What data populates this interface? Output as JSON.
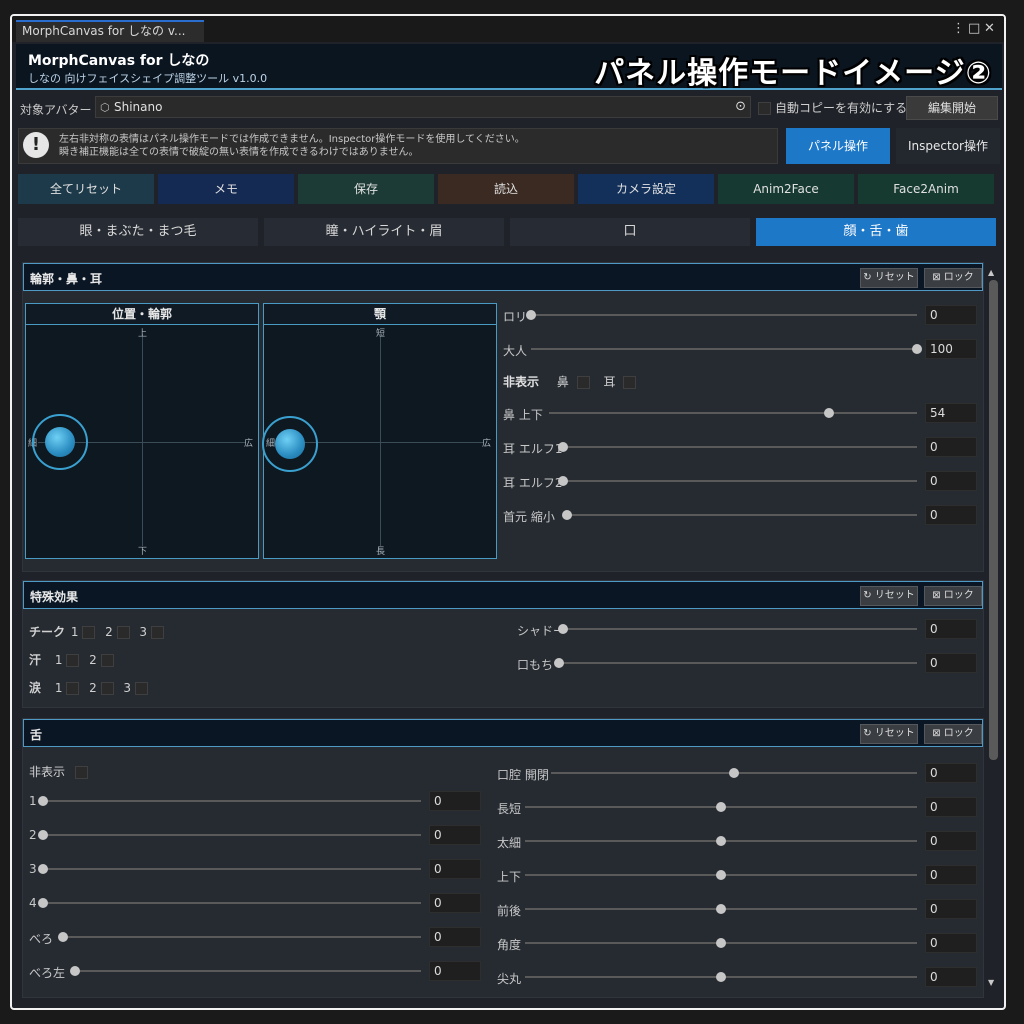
{
  "window": {
    "tab_title": "MorphCanvas for しなの v...",
    "app_title": "MorphCanvas for しなの",
    "app_subtitle": "しなの 向けフェイスシェイプ調整ツール v1.0.0",
    "overlay_caption": "パネル操作モードイメージ②",
    "ctl_menu": "⋮",
    "ctl_max": "□",
    "ctl_close": "✕"
  },
  "target": {
    "label": "対象アバター",
    "avatar_name": "Shinano",
    "auto_copy_label": "自動コピーを有効にする",
    "edit_start": "編集開始"
  },
  "warning": {
    "icon": "!",
    "line1": "左右非対称の表情はパネル操作モードでは作成できません。Inspector操作モードを使用してください。",
    "line2": "瞬き補正機能は全ての表情で破綻の無い表情を作成できるわけではありません。"
  },
  "modes": {
    "panel": "パネル操作",
    "inspector": "Inspector操作"
  },
  "actions": [
    {
      "label": "全てリセット",
      "color": "#1d3a4a"
    },
    {
      "label": "メモ",
      "color": "#142a52"
    },
    {
      "label": "保存",
      "color": "#1d3b36"
    },
    {
      "label": "読込",
      "color": "#3a2a22"
    },
    {
      "label": "カメラ設定",
      "color": "#13305a"
    },
    {
      "label": "Anim2Face",
      "color": "#163a32"
    },
    {
      "label": "Face2Anim",
      "color": "#163a30"
    }
  ],
  "categories": [
    {
      "label": "眼・まぶた・まつ毛"
    },
    {
      "label": "瞳・ハイライト・眉"
    },
    {
      "label": "口"
    },
    {
      "label": "顔・舌・歯"
    }
  ],
  "common": {
    "reset": "↻ リセット",
    "lock": "⊠ ロック"
  },
  "contour": {
    "title": "輪郭・鼻・耳",
    "pad1": {
      "title": "位置・輪郭",
      "top": "上",
      "bottom": "下",
      "left": "細",
      "right": "広"
    },
    "pad2": {
      "title": "顎",
      "top": "短",
      "bottom": "長",
      "left": "細",
      "right": "広"
    },
    "sliders": [
      {
        "label": "ロリ",
        "value": "0",
        "pos": 0
      },
      {
        "label": "大人",
        "value": "100",
        "pos": 1
      },
      {
        "label": "鼻 上下",
        "value": "54",
        "pos": 0.76
      },
      {
        "label": "耳 エルフ1",
        "value": "0",
        "pos": 0
      },
      {
        "label": "耳 エルフ2",
        "value": "0",
        "pos": 0
      },
      {
        "label": "首元 縮小",
        "value": "0",
        "pos": 0
      }
    ],
    "hide": {
      "label": "非表示",
      "nose": "鼻",
      "ear": "耳"
    }
  },
  "special": {
    "title": "特殊効果",
    "cheek": "チーク",
    "sweat": "汗",
    "tears": "涙",
    "n1": "1",
    "n2": "2",
    "n3": "3",
    "sliders": [
      {
        "label": "シャドー",
        "value": "0",
        "pos": 0
      },
      {
        "label": "口もち",
        "value": "0",
        "pos": 0
      }
    ]
  },
  "tongue": {
    "title": "舌",
    "hide_label": "非表示",
    "left": [
      {
        "label": "1",
        "value": "0",
        "pos": 0
      },
      {
        "label": "2",
        "value": "0",
        "pos": 0
      },
      {
        "label": "3",
        "value": "0",
        "pos": 0
      },
      {
        "label": "4",
        "value": "0",
        "pos": 0
      },
      {
        "label": "べろ",
        "value": "0",
        "pos": 0
      },
      {
        "label": "べろ左",
        "value": "0",
        "pos": 0
      }
    ],
    "right": [
      {
        "label": "口腔 開閉",
        "value": "0",
        "pos": 0.5
      },
      {
        "label": "長短",
        "value": "0",
        "pos": 0.5
      },
      {
        "label": "太細",
        "value": "0",
        "pos": 0.5
      },
      {
        "label": "上下",
        "value": "0",
        "pos": 0.5
      },
      {
        "label": "前後",
        "value": "0",
        "pos": 0.5
      },
      {
        "label": "角度",
        "value": "0",
        "pos": 0.5
      },
      {
        "label": "尖丸",
        "value": "0",
        "pos": 0.5
      }
    ]
  },
  "colors": {
    "accent": "#1e78c8",
    "header_border": "#4fa3cc",
    "pad_border": "#4a9bc4"
  }
}
